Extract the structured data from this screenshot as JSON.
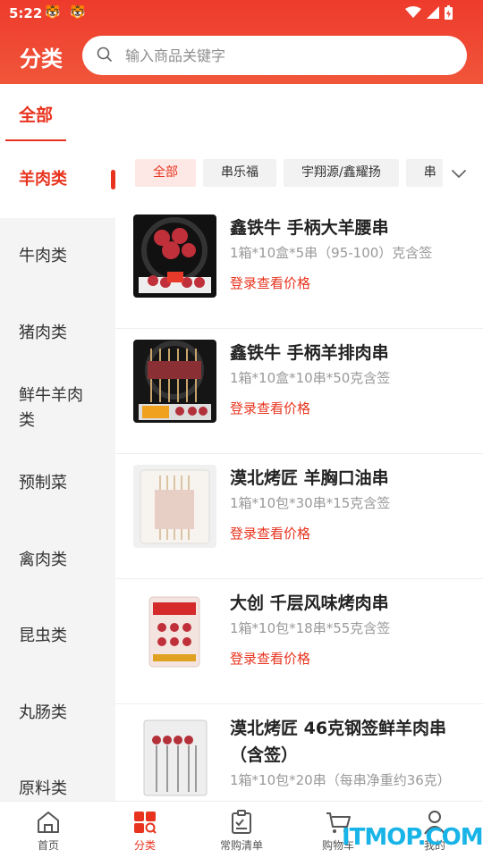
{
  "status_bar": {
    "time": "5:22",
    "notif_glyph_1": "🐯",
    "notif_glyph_2": "🐯"
  },
  "header": {
    "title": "分类",
    "search_placeholder": "输入商品关键字"
  },
  "top_tabs": [
    {
      "label": "全部",
      "active": true
    }
  ],
  "sidebar": {
    "items": [
      {
        "label": "羊肉类",
        "active": true
      },
      {
        "label": "牛肉类"
      },
      {
        "label": "猪肉类"
      },
      {
        "label": "鲜牛羊肉类"
      },
      {
        "label": "预制菜"
      },
      {
        "label": "禽肉类"
      },
      {
        "label": "昆虫类"
      },
      {
        "label": "丸肠类"
      },
      {
        "label": "原料类"
      }
    ]
  },
  "filters": {
    "chips": [
      {
        "label": "全部",
        "active": true
      },
      {
        "label": "串乐福"
      },
      {
        "label": "宇翔源/鑫耀扬"
      },
      {
        "label": "串"
      }
    ]
  },
  "products": [
    {
      "name": "鑫铁牛 手柄大羊腰串",
      "spec": "1箱*10盒*5串（95-100）克含签",
      "price_cta": "登录查看价格"
    },
    {
      "name": "鑫铁牛 手柄羊排肉串",
      "spec": "1箱*10盒*10串*50克含签",
      "price_cta": "登录查看价格"
    },
    {
      "name": "漠北烤匠 羊胸口油串",
      "spec": "1箱*10包*30串*15克含签",
      "price_cta": "登录查看价格"
    },
    {
      "name": "大创 千层风味烤肉串",
      "spec": "1箱*10包*18串*55克含签",
      "price_cta": "登录查看价格"
    },
    {
      "name": "漠北烤匠 46克钢签鲜羊肉串（含签）",
      "spec": "1箱*10包*20串（每串净重约36克）",
      "price_cta": ""
    }
  ],
  "bottom_nav": [
    {
      "label": "首页",
      "icon": "home-icon"
    },
    {
      "label": "分类",
      "icon": "category-icon",
      "active": true
    },
    {
      "label": "常购清单",
      "icon": "list-icon"
    },
    {
      "label": "购物车",
      "icon": "cart-icon"
    },
    {
      "label": "我的",
      "icon": "user-icon"
    }
  ],
  "watermark": "ITMOP.COM",
  "colors": {
    "brand": "#e8341f",
    "header_gradient_start": "#ee3a2c"
  }
}
